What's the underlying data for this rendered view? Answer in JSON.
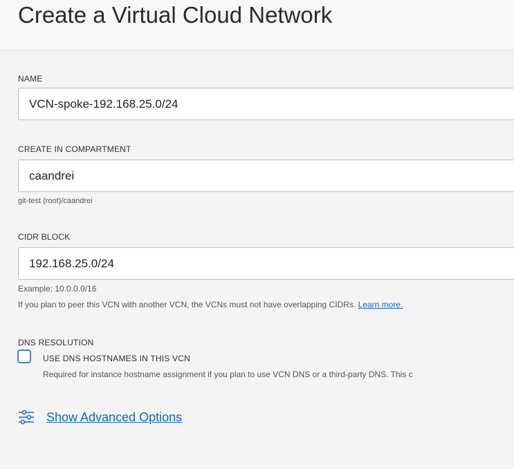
{
  "header": {
    "title": "Create a Virtual Cloud Network"
  },
  "name": {
    "label": "NAME",
    "value": "VCN-spoke-192.168.25.0/24"
  },
  "compartment": {
    "label": "CREATE IN COMPARTMENT",
    "value": "caandrei",
    "path": "git-test (root)/caandrei"
  },
  "cidr": {
    "label": "CIDR BLOCK",
    "value": "192.168.25.0/24",
    "example": "Example: 10.0.0.0/16",
    "note": "If you plan to peer this VCN with another VCN, the VCNs must not have overlapping CIDRs.",
    "learn_more": "Learn more."
  },
  "dns": {
    "section_label": "DNS RESOLUTION",
    "checkbox_label": "USE DNS HOSTNAMES IN THIS VCN",
    "checked": false,
    "description": "Required for instance hostname assignment if you plan to use VCN DNS or a third-party DNS. This c"
  },
  "advanced": {
    "label": "Show Advanced Options",
    "icon": "sliders-icon"
  },
  "colors": {
    "link": "#1565c0",
    "checkbox_border": "#4c7fbf"
  }
}
